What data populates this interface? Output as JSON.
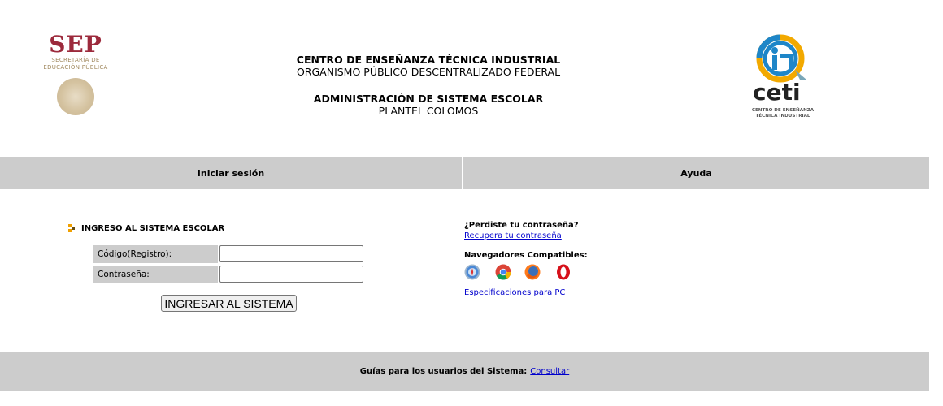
{
  "header": {
    "sep_logo": {
      "title": "SEP",
      "subtitle_line1": "SECRETARÍA DE",
      "subtitle_line2": "EDUCACIÓN PÚBLICA"
    },
    "title_line1": "CENTRO DE ENSEÑANZA TÉCNICA INDUSTRIAL",
    "title_line2": "ORGANISMO PÚBLICO DESCENTRALIZADO FEDERAL",
    "title_line3": "ADMINISTRACIÓN DE SISTEMA ESCOLAR",
    "title_line4": "PLANTEL COLOMOS",
    "ceti_logo": {
      "word": "ceti",
      "subtitle_line1": "CENTRO DE ENSEÑANZA",
      "subtitle_line2": "TÉCNICA INDUSTRIAL"
    }
  },
  "nav": {
    "login_tab": "Iniciar sesión",
    "help_tab": "Ayuda"
  },
  "login": {
    "heading": "INGRESO AL SISTEMA ESCOLAR",
    "code_label": "Código(Registro):",
    "code_value": "",
    "password_label": "Contraseña:",
    "password_value": "",
    "submit_label": "INGRESAR AL SISTEMA"
  },
  "help": {
    "forgot_title": "¿Perdiste tu contraseña?",
    "recover_link": "Recupera tu contraseña",
    "browsers_title": "Navegadores Compatibles:",
    "browsers": [
      "safari-icon",
      "chrome-icon",
      "firefox-icon",
      "opera-icon"
    ],
    "specs_link": "Especificaciones para PC"
  },
  "footer": {
    "label": "Guías para los usuarios del Sistema:",
    "link": "Consultar"
  },
  "colors": {
    "bar_gray": "#cccccc",
    "link_blue": "#0000cc",
    "sep_red": "#9c2a3c",
    "bullet_orange": "#f0a000"
  }
}
